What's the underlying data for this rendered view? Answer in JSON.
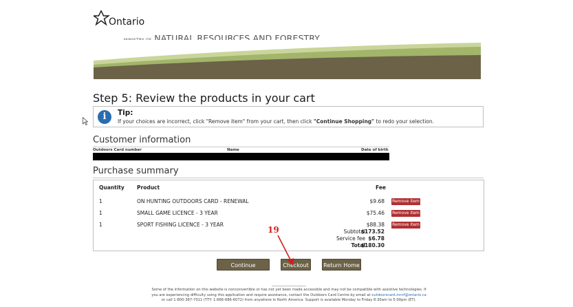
{
  "header": {
    "logo_text": "Ontario",
    "ministry_prefix": "MINISTRY OF",
    "ministry_name": "NATURAL RESOURCES AND FORESTRY"
  },
  "step_title": "Step 5: Review the products in your cart",
  "tip": {
    "icon": "info-icon",
    "title": "Tip:",
    "text_before": "If your choices are incorrect, click \"Remove item\" from your cart, then click ",
    "text_bold": "\"Continue Shopping\"",
    "text_after": " to redo your selection."
  },
  "customer": {
    "title": "Customer information",
    "headers": [
      "Outdoors Card number",
      "Name",
      "Date of birth"
    ]
  },
  "purchase": {
    "title": "Purchase summary",
    "headers": {
      "qty": "Quantity",
      "product": "Product",
      "fee": "Fee"
    },
    "rows": [
      {
        "qty": "1",
        "product": "ON HUNTING OUTDOORS CARD - RENEWAL",
        "fee": "$9.68",
        "remove": "Remove item"
      },
      {
        "qty": "1",
        "product": "SMALL GAME LICENCE - 3 YEAR",
        "fee": "$75.46",
        "remove": "Remove item"
      },
      {
        "qty": "1",
        "product": "SPORT FISHING LICENCE - 3 YEAR",
        "fee": "$88.38",
        "remove": "Remove item"
      }
    ],
    "subtotal_label": "Subtotal",
    "subtotal": "$173.52",
    "service_label": "Service fee",
    "service": "$6.78",
    "total_label": "Total",
    "total": "$180.30"
  },
  "buttons": {
    "continue": "Continue Shopping",
    "checkout": "Checkout",
    "home": "Return Home"
  },
  "annotation": {
    "number": "19",
    "color": "#d21c1c"
  },
  "footer": {
    "line1": "Some of the information on this website is nonconvertible or has not yet been made accessible and may not be compatible with assistive technologies. If",
    "line2a": "you are experiencing difficulty using this application and require assistance, contact the Outdoors Card Centre by email at ",
    "email": "outdoorscard.mnrf@ontario.ca",
    "line3": "or call 1-800-387-7011 (TTY: 1-866-686-6072) from anywhere in North America. Support is available Monday to Friday 8:30am to 5:00pm (ET)."
  },
  "colors": {
    "brand_olive": "#6b6248",
    "remove_red": "#b03032",
    "info_blue": "#2a6cb0",
    "banner_green": "#8fa35a"
  }
}
